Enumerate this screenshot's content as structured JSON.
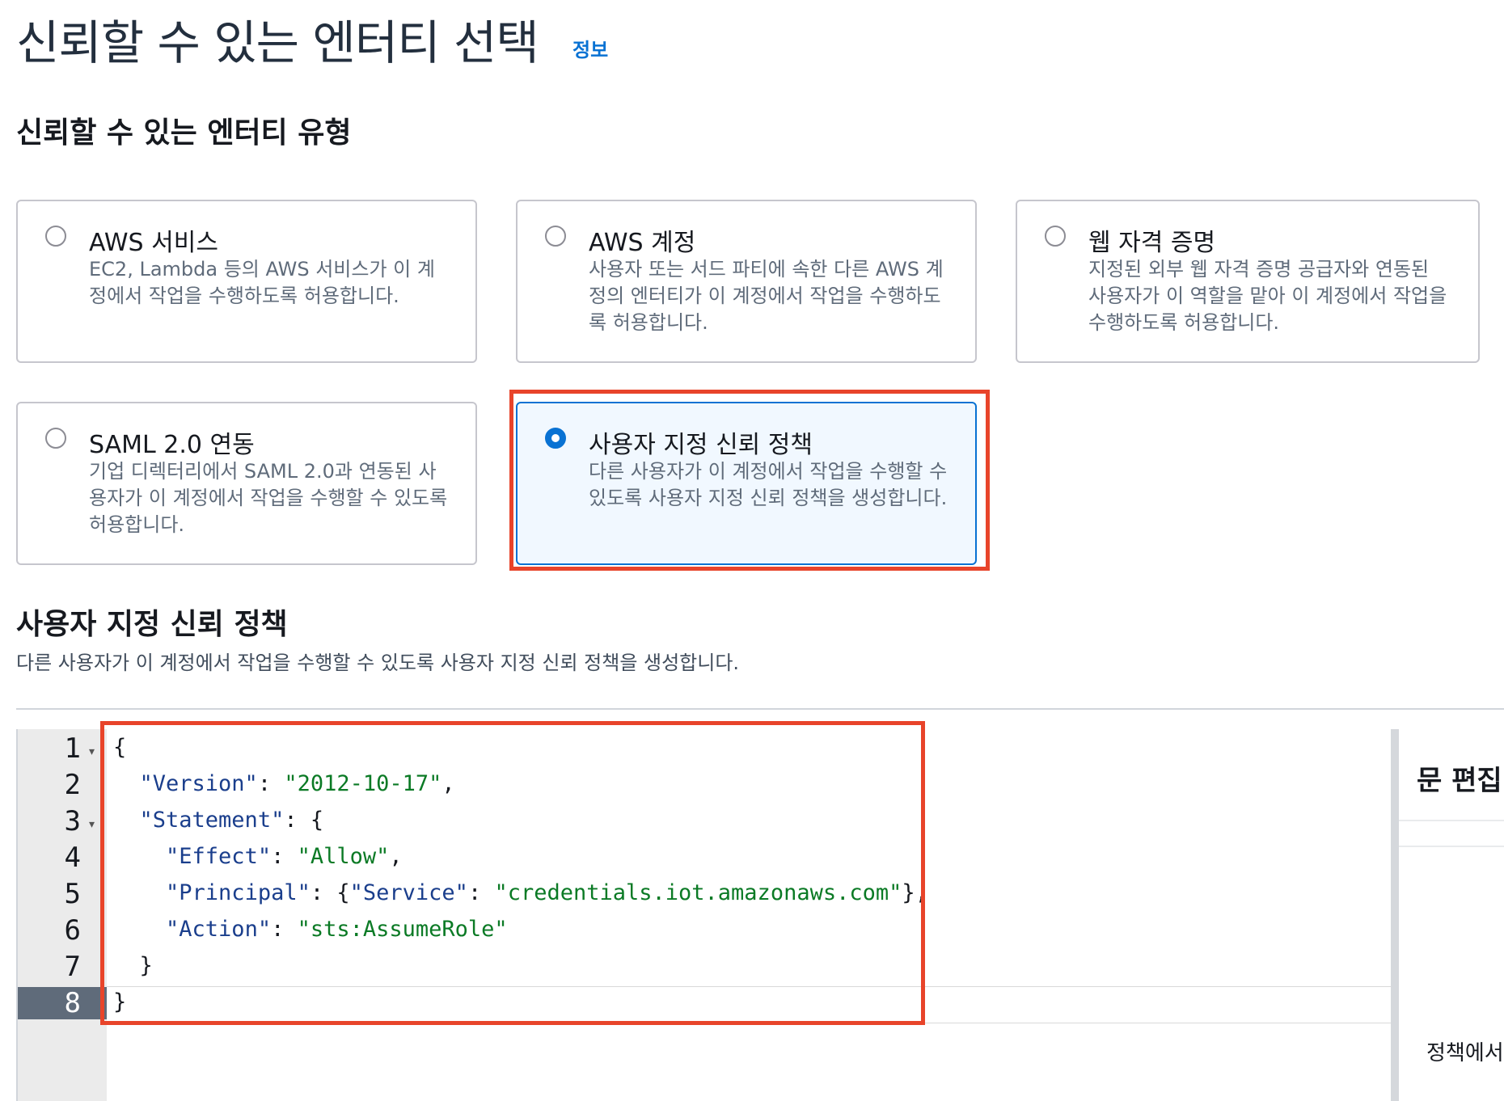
{
  "header": {
    "title": "신뢰할 수 있는 엔터티 선택",
    "info_link": "정보"
  },
  "entity_type": {
    "section_title": "신뢰할 수 있는 엔터티 유형",
    "options": [
      {
        "label": "AWS 서비스",
        "description": "EC2, Lambda 등의 AWS 서비스가 이 계정에서 작업을 수행하도록 허용합니다.",
        "selected": false
      },
      {
        "label": "AWS 계정",
        "description": "사용자 또는 서드 파티에 속한 다른 AWS 계정의 엔터티가 이 계정에서 작업을 수행하도록 허용합니다.",
        "selected": false
      },
      {
        "label": "웹 자격 증명",
        "description": "지정된 외부 웹 자격 증명 공급자와 연동된 사용자가 이 역할을 맡아 이 계정에서 작업을 수행하도록 허용합니다.",
        "selected": false
      },
      {
        "label": "SAML 2.0 연동",
        "description": "기업 디렉터리에서 SAML 2.0과 연동된 사용자가 이 계정에서 작업을 수행할 수 있도록 허용합니다.",
        "selected": false
      },
      {
        "label": "사용자 지정 신뢰 정책",
        "description": "다른 사용자가 이 계정에서 작업을 수행할 수 있도록 사용자 지정 신뢰 정책을 생성합니다.",
        "selected": true
      }
    ]
  },
  "custom_policy": {
    "title": "사용자 지정 신뢰 정책",
    "description": "다른 사용자가 이 계정에서 작업을 수행할 수 있도록 사용자 지정 신뢰 정책을 생성합니다."
  },
  "editor": {
    "line_numbers": [
      "1",
      "2",
      "3",
      "4",
      "5",
      "6",
      "7",
      "8"
    ],
    "active_line": "8",
    "lines": [
      "{",
      "  \"Version\": \"2012-10-17\",",
      "  \"Statement\": {",
      "    \"Effect\": \"Allow\",",
      "    \"Principal\": {\"Service\": \"credentials.iot.amazonaws.com\"},",
      "    \"Action\": \"sts:AssumeRole\"",
      "  }",
      "}"
    ]
  },
  "side_panel": {
    "header": "문 편집",
    "note": "정책에서"
  },
  "colors": {
    "accent": "#0972d3",
    "highlight": "#e8442a",
    "string": "#0b7a25",
    "key": "#1a3e8c"
  }
}
